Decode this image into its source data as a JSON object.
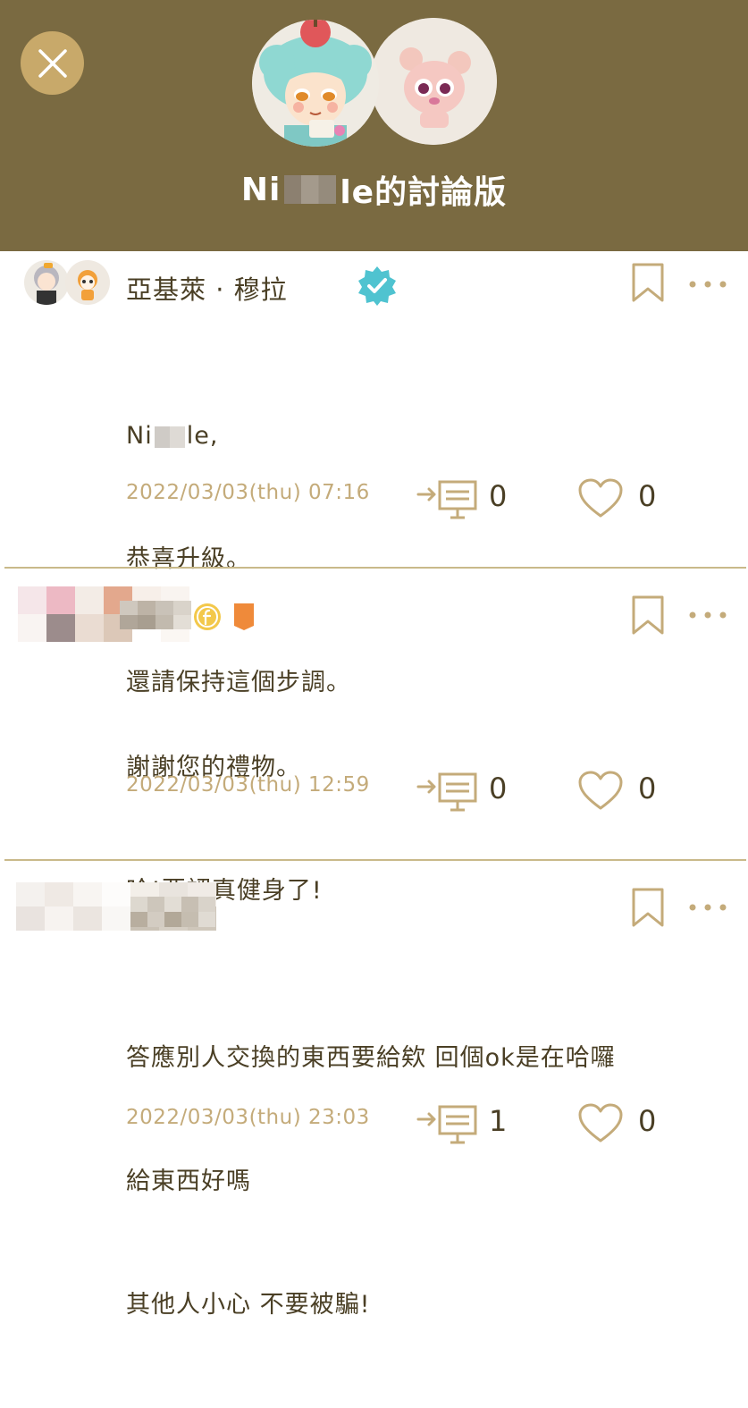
{
  "header": {
    "title_prefix": "Ni",
    "title_suffix": "le的討論版"
  },
  "posts": [
    {
      "author": "亞基萊 · 穆拉",
      "body_prefix": "Ni",
      "body_suffix": "le,",
      "body_lines": [
        "恭喜升級。",
        "還請保持這個步調。"
      ],
      "timestamp": "2022/03/03(thu) 07:16",
      "reply_count": "0",
      "like_count": "0"
    },
    {
      "author": "",
      "body_lines": [
        "謝謝您的禮物。",
        "哈!要認真健身了!"
      ],
      "timestamp": "2022/03/03(thu) 12:59",
      "reply_count": "0",
      "like_count": "0"
    },
    {
      "author": "",
      "body_lines": [
        "答應別人交換的東西要給欸 回個ok是在哈囉",
        "給東西好嗎",
        "其他人小心 不要被騙!"
      ],
      "timestamp": "2022/03/03(thu) 23:03",
      "reply_count": "1",
      "like_count": "0"
    }
  ],
  "colors": {
    "header_bg": "#7a6a41",
    "accent": "#c8a96a",
    "verified": "#4fc3d0",
    "text": "#4a3f25",
    "timestamp": "#c4ab7a"
  },
  "icons": [
    "close-icon",
    "bookmark-icon",
    "more-icon",
    "reply-icon",
    "heart-icon",
    "verified-badge-icon",
    "coin-badge-icon",
    "rank-badge-icon"
  ]
}
